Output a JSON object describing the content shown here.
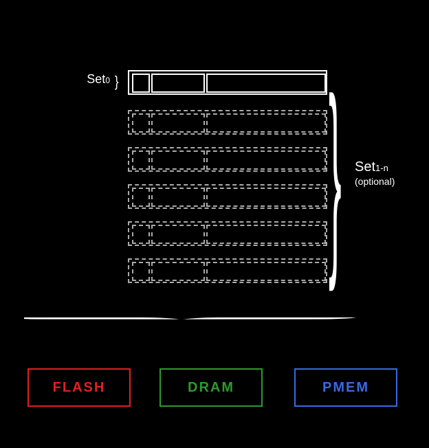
{
  "diagram": {
    "set0_label_main": "Set",
    "set0_label_sub": "0",
    "right_label_main": "Set",
    "right_label_sub": "1-n",
    "right_label_optional": "(optional)",
    "memory_types": {
      "flash": "FLASH",
      "dram": "DRAM",
      "pmem": "PMEM"
    },
    "brace_bottom_glyph": "}",
    "brace_left_glyph": "}",
    "brace_right_glyph": "}"
  }
}
